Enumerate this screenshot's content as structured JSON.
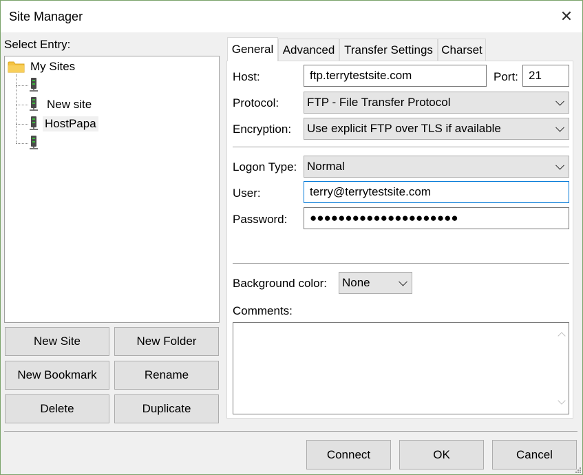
{
  "window": {
    "title": "Site Manager"
  },
  "left": {
    "select_entry_label": "Select Entry:",
    "tree": {
      "root": "My Sites",
      "items": [
        "",
        "New site",
        "HostPapa",
        ""
      ]
    },
    "buttons": {
      "new_site": "New Site",
      "new_folder": "New Folder",
      "new_bookmark": "New Bookmark",
      "rename": "Rename",
      "delete": "Delete",
      "duplicate": "Duplicate"
    }
  },
  "tabs": [
    "General",
    "Advanced",
    "Transfer Settings",
    "Charset"
  ],
  "general": {
    "host_label": "Host:",
    "host_value": "ftp.terrytestsite.com",
    "port_label": "Port:",
    "port_value": "21",
    "protocol_label": "Protocol:",
    "protocol_value": "FTP - File Transfer Protocol",
    "encryption_label": "Encryption:",
    "encryption_value": "Use explicit FTP over TLS if available",
    "logon_type_label": "Logon Type:",
    "logon_type_value": "Normal",
    "user_label": "User:",
    "user_value": "terry@terrytestsite.com",
    "password_label": "Password:",
    "password_value": "●●●●●●●●●●●●●●●●●●●●●",
    "bg_color_label": "Background color:",
    "bg_color_value": "None",
    "comments_label": "Comments:",
    "comments_value": ""
  },
  "footer": {
    "connect": "Connect",
    "ok": "OK",
    "cancel": "Cancel"
  },
  "colors": {
    "accent": "#0078d7",
    "folder": "#f5c342",
    "window_border": "#7aa36a"
  }
}
